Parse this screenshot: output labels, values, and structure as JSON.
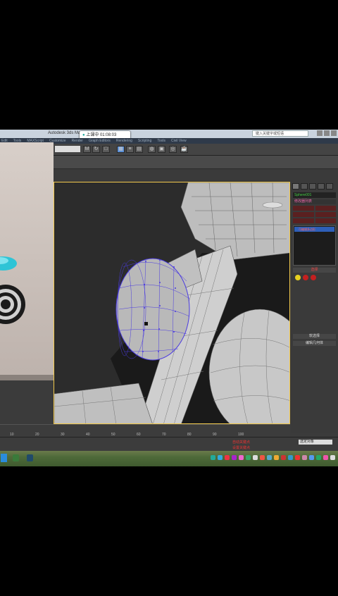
{
  "window": {
    "title": "Autodesk 3ds Max",
    "search_placeholder": "键入关键字或短语"
  },
  "timer_chip": {
    "label": "上课中 01:08:03",
    "chevron": "^"
  },
  "menu": {
    "items": [
      "Edit",
      "Tools",
      "MAXScript",
      "Customize",
      "Render",
      "Graph Editors",
      "Rendering",
      "Scripting",
      "Tools",
      "Civil View"
    ]
  },
  "toolbar": {
    "selection_set_value": "",
    "icons": [
      "move-icon",
      "rotate-icon",
      "scale-icon",
      "select-icon",
      "region-icon",
      "layer-icon",
      "material-icon",
      "render-setup-icon",
      "render-icon",
      "teapot-icon"
    ]
  },
  "command_panel": {
    "object_name": "Sphere001",
    "modifier_list_label": "修改器列表",
    "modifier_stack_item": "可编辑多边形",
    "rollout_selection": "选择",
    "rollout_soft_selection": "软选择",
    "rollout_edit_geometry": "编辑几何体"
  },
  "timeline": {
    "ticks": [
      "10",
      "20",
      "30",
      "40",
      "50",
      "60",
      "70",
      "80",
      "90",
      "100"
    ]
  },
  "status": {
    "key_mode": "自动关键点",
    "set_key": "设置关键点",
    "filter": "选定对象"
  },
  "colors": {
    "accent": "#5b8fd6",
    "viewport_border": "#f2c94c",
    "selection_wire": "#5040e0",
    "panel_red": "#e44444"
  }
}
